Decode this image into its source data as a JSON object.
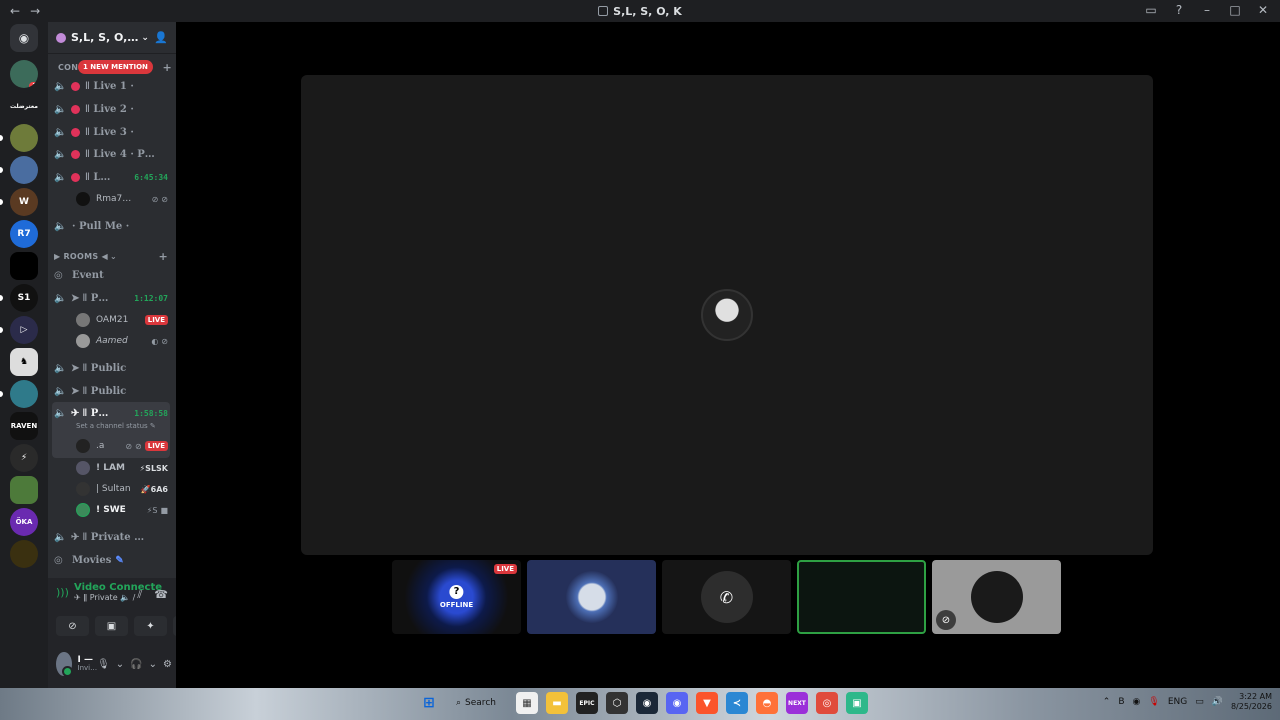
{
  "window": {
    "title": "S,L, S, O, K"
  },
  "server": {
    "name": "S,L, S, O,…"
  },
  "mention_pill": "1 NEW MENTION",
  "categories": {
    "connect_label": "CON",
    "rooms_label": "ROOMS ◀"
  },
  "channels": [
    {
      "label": "ǁ Live 1 ·",
      "timer": ""
    },
    {
      "label": "ǁ Live 2 ·",
      "timer": ""
    },
    {
      "label": "ǁ Live 3 ·",
      "timer": ""
    },
    {
      "label": "ǁ Live 4 · P…",
      "timer": ""
    },
    {
      "label": "ǁ L…",
      "timer": "6:45:34"
    },
    {
      "label": "· Pull Me ·",
      "timer": ""
    },
    {
      "label": "Event",
      "timer": ""
    },
    {
      "label": "ǁ P…",
      "timer": "1:12:07"
    },
    {
      "label": "ǁ Public",
      "timer": ""
    },
    {
      "label": "ǁ Public",
      "timer": ""
    },
    {
      "label": "ǁ P…",
      "timer": "1:58:58"
    },
    {
      "label": "ǁ Private …",
      "timer": ""
    },
    {
      "label": "Movies",
      "timer": ""
    }
  ],
  "users": [
    {
      "name": "Rma7…"
    },
    {
      "name": "OAM21",
      "badge": "LIVE"
    },
    {
      "name": "Aamed"
    },
    {
      "name": ".a",
      "badge": "LIVE"
    },
    {
      "name": "! LAM",
      "tag": "⚡SLSK"
    },
    {
      "name": "| Sultan",
      "tag": "🚀6A6"
    },
    {
      "name": "! SWE",
      "tag": "⚡S"
    }
  ],
  "channel_status_hint": "Set a channel status ✎",
  "voice": {
    "status": "Video Connecte",
    "channel": "✈ ǁ Private 🔈 /"
  },
  "me": {
    "name": "I —",
    "status": "Invi…"
  },
  "thumbs": {
    "live_label": "LIVE",
    "offline_label": "OFFLINE"
  },
  "taskbar": {
    "search": "Search",
    "lang": "ENG",
    "time": "3:22 AM",
    "date": "8/25/2026"
  },
  "guild_labels": {
    "g2": "معترضلت",
    "g8": "S1",
    "g12": "RAVEN",
    "g15": "ÖKA",
    "r7": "R7"
  },
  "colors": {
    "accent_green": "#23a55a",
    "live_red": "#da373c",
    "sidebar": "#2b2d31",
    "guild_bar": "#1e1f22"
  }
}
